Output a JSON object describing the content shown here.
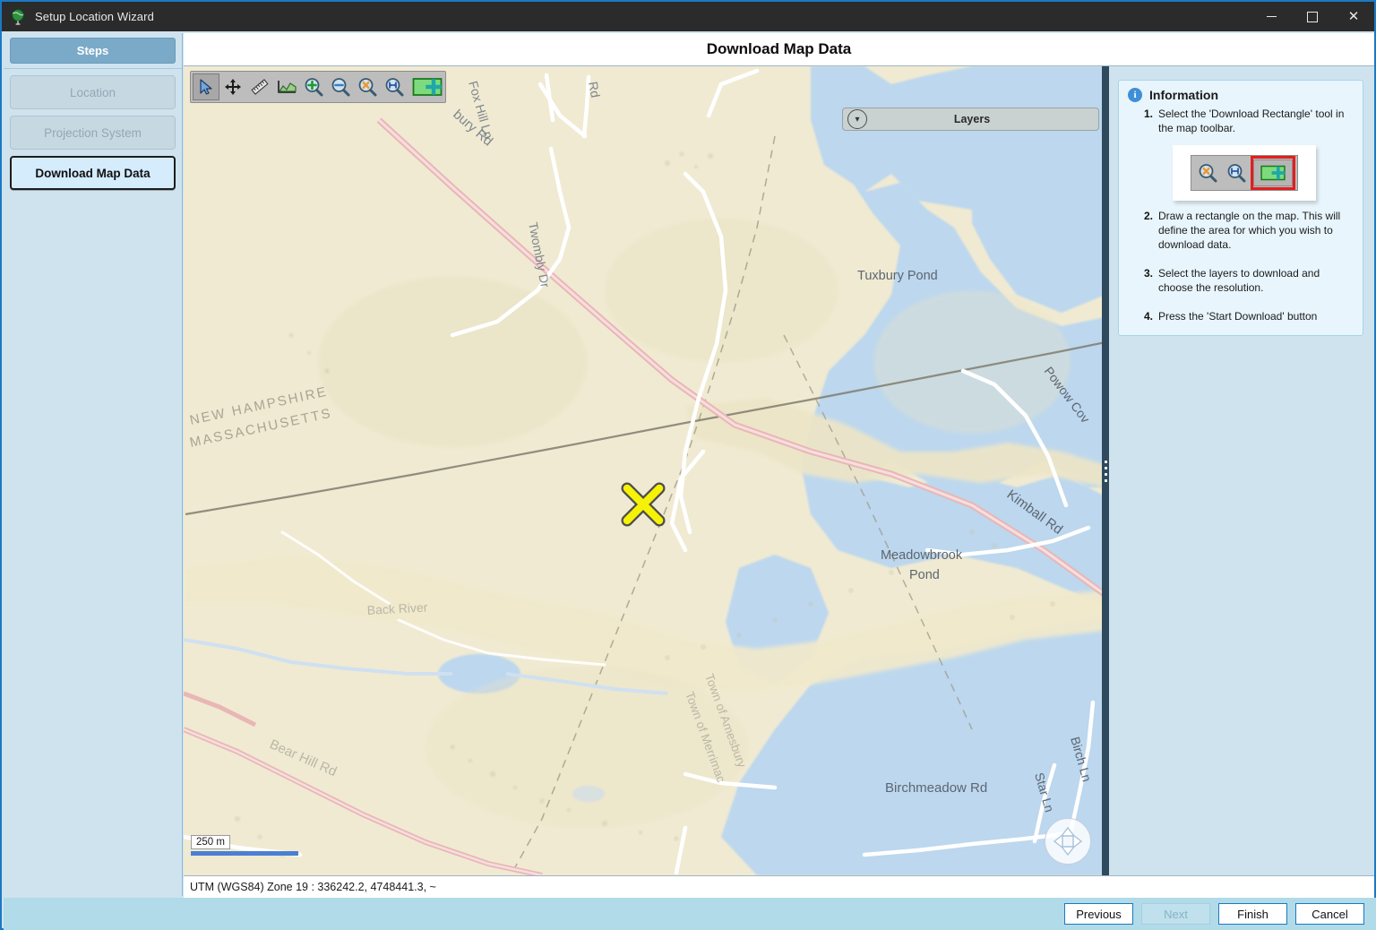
{
  "window": {
    "title": "Setup Location Wizard",
    "icon": "globe-icon",
    "minimize_label": "—",
    "maximize_label": "□",
    "close_label": "✕"
  },
  "sidebar": {
    "header": "Steps",
    "items": [
      {
        "label": "Location",
        "state": "disabled"
      },
      {
        "label": "Projection System",
        "state": "disabled"
      },
      {
        "label": "Download Map Data",
        "state": "active"
      }
    ]
  },
  "header": {
    "title": "Download Map Data"
  },
  "map_toolbar": {
    "tools": [
      {
        "name": "select-arrow-tool",
        "title": "Select",
        "selected": true
      },
      {
        "name": "pan-tool",
        "title": "Pan",
        "selected": false
      },
      {
        "name": "measure-ruler-tool",
        "title": "Measure",
        "selected": false
      },
      {
        "name": "profile-graph-tool",
        "title": "Profile",
        "selected": false
      },
      {
        "name": "zoom-in-tool",
        "title": "Zoom In",
        "selected": false
      },
      {
        "name": "zoom-out-tool",
        "title": "Zoom Out",
        "selected": false
      },
      {
        "name": "zoom-reset-tool",
        "title": "Zoom Reset",
        "selected": false
      },
      {
        "name": "zoom-extent-tool",
        "title": "Zoom To Extent",
        "selected": false
      },
      {
        "name": "download-rectangle-tool",
        "title": "Download Rectangle",
        "selected": false
      }
    ]
  },
  "layers_bar": {
    "label": "Layers",
    "chevron": "⌄"
  },
  "map": {
    "scale_label": "250 m",
    "marker": "location-x-marker",
    "labels": [
      "Fox Hill Ln",
      "Rd",
      "bury Rd",
      "Twombly Dr",
      "NEW HAMPSHIRE",
      "MASSACHUSETTS",
      "Tuxbury Pond",
      "Powow Cov",
      "Kimball Rd",
      "Meadowbrook",
      "Pond",
      "Back River",
      "Town of Amesbury",
      "Town of Merrimac",
      "Bear Hill Rd",
      "Birchmeadow Rd",
      "Star Ln",
      "Birch Ln"
    ]
  },
  "status_bar": {
    "text": "UTM (WGS84) Zone 19   : 336242.2, 4748441.3, ~"
  },
  "information": {
    "title": "Information",
    "steps": [
      {
        "num": "1.",
        "text": "Select the 'Download Rectangle' tool in the map toolbar."
      },
      {
        "num": "2.",
        "text": "Draw a rectangle on the map. This will define the area for which you wish to download data."
      },
      {
        "num": "3.",
        "text": "Select the layers to download and choose the resolution."
      },
      {
        "num": "4.",
        "text": "Press the 'Start Download' button"
      }
    ]
  },
  "footer": {
    "buttons": [
      {
        "label": "Previous",
        "state": "enabled"
      },
      {
        "label": "Next",
        "state": "disabled"
      },
      {
        "label": "Finish",
        "state": "enabled"
      },
      {
        "label": "Cancel",
        "state": "enabled"
      }
    ]
  },
  "colors": {
    "accent": "#1a7ac4",
    "titlebar": "#2b2b2b",
    "sidebar": "#cfe3ef",
    "active_step": "#d4ecfb",
    "highlight_red": "#e31e1e",
    "marker_yellow": "#f5f207",
    "water": "#bcd7ee",
    "land": "#f0ead2"
  }
}
